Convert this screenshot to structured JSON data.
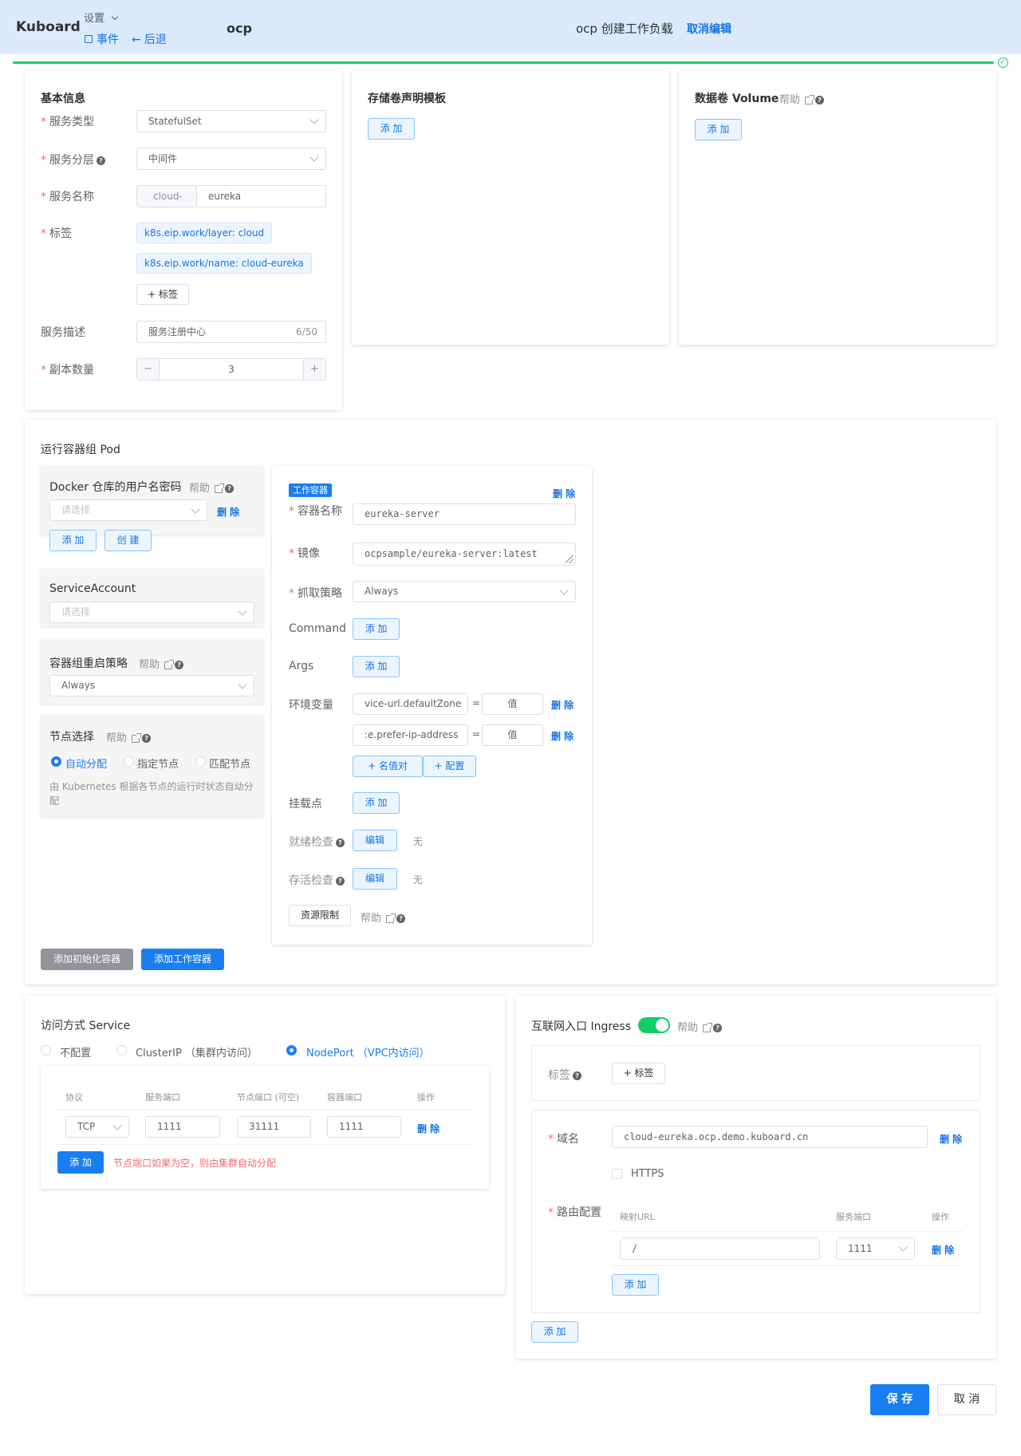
{
  "header": {
    "brand": "Kuboard",
    "settings": "设置",
    "events": "事件",
    "back": "后退",
    "project": "ocp",
    "title": "ocp 创建工作负载",
    "cancel_edit": "取消编辑"
  },
  "basic": {
    "title": "基本信息",
    "service_type_label": "服务类型",
    "service_type": "StatefulSet",
    "service_layer_label": "服务分层",
    "service_layer": "中间件",
    "service_name_label": "服务名称",
    "name_prefix": "cloud-",
    "name": "eureka",
    "labels_label": "标签",
    "labels": [
      "k8s.eip.work/layer: cloud",
      "k8s.eip.work/name: cloud-eureka"
    ],
    "add_label": "+ 标签",
    "desc_label": "服务描述",
    "desc": "服务注册中心",
    "desc_count": "6/50",
    "replicas_label": "副本数量",
    "replicas": "3",
    "minus": "−",
    "plus": "+"
  },
  "pvc": {
    "title": "存储卷声明模板",
    "add": "添 加"
  },
  "volume": {
    "title": "数据卷 Volume",
    "help": "帮助",
    "add": "添 加"
  },
  "pod": {
    "title": "运行容器组 Pod",
    "docker": {
      "title": "Docker 仓库的用户名密码",
      "help": "帮助",
      "placeholder": "请选择",
      "delete": "删 除",
      "add": "添 加",
      "create": "创 建"
    },
    "sa": {
      "title": "ServiceAccount",
      "placeholder": "请选择"
    },
    "restart": {
      "title": "容器组重启策略",
      "help": "帮助",
      "value": "Always"
    },
    "node": {
      "title": "节点选择",
      "help": "帮助",
      "opt_auto": "自动分配",
      "opt_node": "指定节点",
      "opt_match": "匹配节点",
      "desc": "由 Kubernetes 根据各节点的运行时状态自动分配"
    },
    "add_init": "添加初始化容器",
    "add_work": "添加工作容器"
  },
  "container": {
    "badge": "工作容器",
    "delete": "删 除",
    "name_label": "容器名称",
    "name": "eureka-server",
    "image_label": "镜像",
    "image": "ocpsample/eureka-server:latest",
    "pull_label": "抓取策略",
    "pull": "Always",
    "command_label": "Command",
    "args_label": "Args",
    "add": "添 加",
    "env_label": "环境变量",
    "env": [
      {
        "key": "vice-url.defaultZone",
        "eq": "=",
        "value": "值",
        "del": "删 除"
      },
      {
        "key": ":e.prefer-ip-address",
        "eq": "=",
        "value": "值",
        "del": "删 除"
      }
    ],
    "add_kv": "+ 名值对",
    "add_cfg": "+ 配置",
    "mount_label": "挂载点",
    "ready_label": "就绪检查",
    "live_label": "存活检查",
    "edit": "编辑",
    "none": "无",
    "resource": "资源限制",
    "help": "帮助"
  },
  "service": {
    "title": "访问方式 Service",
    "opt_none": "不配置",
    "opt_cluster": "ClusterIP （集群内访问）",
    "opt_node": "NodePort （VPC内访问）",
    "headers": {
      "protocol": "协议",
      "port": "服务端口",
      "node_port": "节点端口 (可空)",
      "target": "容器端口",
      "ops": "操作"
    },
    "row": {
      "protocol": "TCP",
      "port": "1111",
      "node_port": "31111",
      "target": "1111",
      "del": "删 除"
    },
    "add": "添 加",
    "note": "节点端口如果为空，则由集群自动分配"
  },
  "ingress": {
    "title": "互联网入口 Ingress",
    "help": "帮助",
    "labels_label": "标签",
    "add_label": "+ 标签",
    "domain_label": "域名",
    "domain": "cloud-eureka.ocp.demo.kuboard.cn",
    "del": "删 除",
    "https": "HTTPS",
    "route_label": "路由配置",
    "headers": {
      "url": "映射URL",
      "port": "服务端口",
      "ops": "操作"
    },
    "route": {
      "path": "/",
      "port": "1111",
      "del": "删 除"
    },
    "add_route": "添 加",
    "add_rule": "添 加"
  },
  "footer": {
    "save": "保 存",
    "cancel": "取 消"
  },
  "colors": {
    "primary": "#1a7ef3",
    "header_bg": "#dbe9fb",
    "success": "#13ce66",
    "danger": "#f56c6c"
  }
}
